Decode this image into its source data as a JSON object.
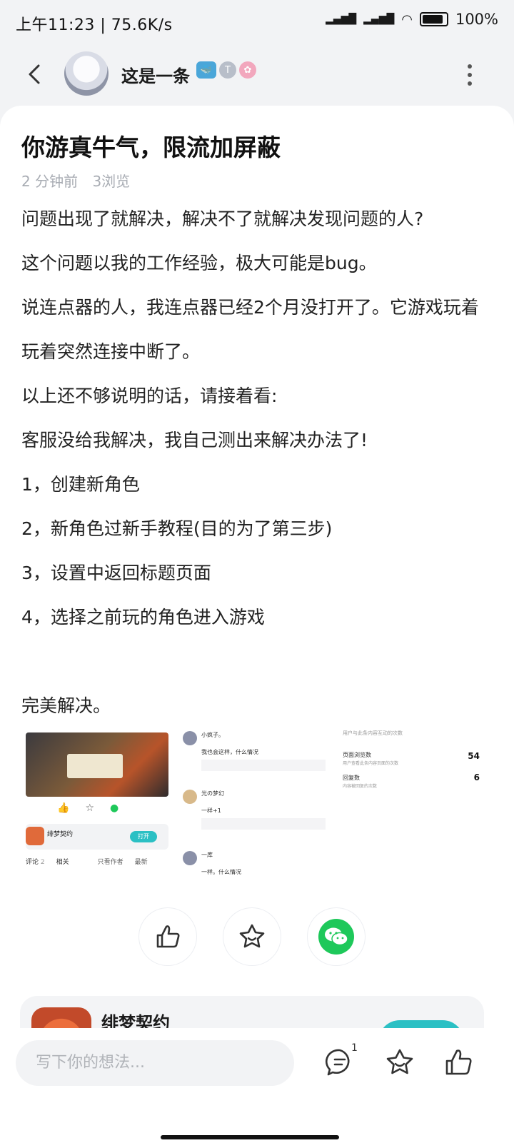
{
  "status_bar": {
    "time_speed": "上午11:23 | 75.6K/s",
    "battery": "100%"
  },
  "header": {
    "author": "这是一条",
    "back_icon": "chevron-left-icon",
    "more_icon": "more-vertical-icon"
  },
  "post": {
    "title": "你游真牛气，限流加屏蔽",
    "time": "2 分钟前",
    "views": "3浏览",
    "paragraphs": [
      "问题出现了就解决，解决不了就解决发现问题的人?",
      "这个问题以我的工作经验，极大可能是bug。",
      "说连点器的人，我连点器已经2个月没打开了。它游戏玩着玩着突然连接中断了。",
      "以上还不够说明的话，请接着看:",
      "客服没给我解决，我自己测出来解决办法了!",
      "1，创建新角色",
      "2，新角色过新手教程(目的为了第三步)",
      "3，设置中返回标题页面",
      "4，选择之前玩的角色进入游戏",
      "完美解决。"
    ]
  },
  "images": {
    "img1": {
      "app_name": "绯梦契约",
      "open_label": "打开",
      "tab_comments": "评论",
      "tab_comments_count": "2",
      "tab_related": "相关",
      "only_author": "只看作者",
      "latest": "最新"
    },
    "img2": {
      "comments": [
        {
          "name": "小疯子。",
          "text": "我也会这样，什么情况"
        },
        {
          "name": "光の梦幻",
          "text": "一样+1"
        },
        {
          "name": "一库",
          "text": "一样。什么情况"
        }
      ]
    },
    "img3": {
      "header": "用户与此条内容互动的次数",
      "stats": [
        {
          "label": "页面浏览数",
          "desc": "用户查看此条内容页面的次数",
          "value": "54"
        },
        {
          "label": "回复数",
          "desc": "内容被回复的次数",
          "value": "6"
        }
      ]
    }
  },
  "actions": {
    "like_icon": "thumbs-up-icon",
    "favorite_icon": "star-icon",
    "share_icon": "wechat-icon"
  },
  "app_card": {
    "name": "绯梦契约"
  },
  "bottom_bar": {
    "placeholder": "写下你的想法...",
    "comment_count": "1"
  },
  "colors": {
    "accent": "#2bc0c4",
    "wechat": "#1ec85a",
    "background": "#f2f3f5"
  }
}
